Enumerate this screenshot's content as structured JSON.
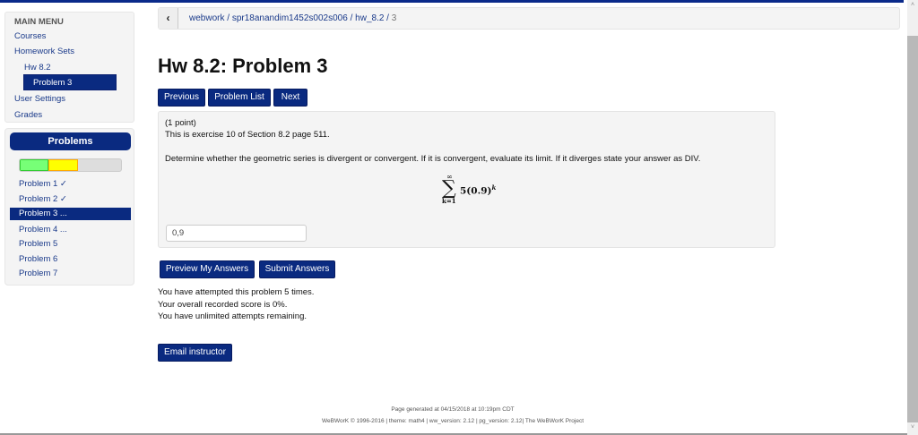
{
  "menu": {
    "title": "MAIN MENU",
    "items": [
      "Courses",
      "Homework Sets",
      "Hw 8.2",
      "Problem 3",
      "User Settings",
      "Grades"
    ]
  },
  "problems": {
    "title": "Problems",
    "progress": {
      "correct_fraction": 0.286,
      "attempted_fraction": 0.286
    },
    "items": [
      "Problem 1 ✓",
      "Problem 2 ✓",
      "Problem 3 ...",
      "Problem 4 ...",
      "Problem 5",
      "Problem 6",
      "Problem 7"
    ]
  },
  "breadcrumb": {
    "back": "‹",
    "parts": [
      "webwork",
      "spr18anandim1452s002s006",
      "hw_8.2"
    ],
    "current": "3"
  },
  "title": "Hw 8.2: Problem 3",
  "nav": {
    "previous": "Previous",
    "list": "Problem List",
    "next": "Next"
  },
  "problem": {
    "points": "(1 point)",
    "exercise": "This is exercise 10 of Section 8.2 page 511.",
    "question": "Determine whether the geometric series is divergent or convergent. If it is convergent, evaluate its limit. If it diverges state your answer as DIV.",
    "math": {
      "upper": "∞",
      "lower": "k=1",
      "term": "5(0.9)",
      "exp": "k"
    },
    "answer": "0,9"
  },
  "actions": {
    "preview": "Preview My Answers",
    "submit": "Submit Answers"
  },
  "status": [
    "You have attempted this problem 5 times.",
    "Your overall recorded score is 0%.",
    "You have unlimited attempts remaining."
  ],
  "email": "Email instructor",
  "footer": {
    "generated": "Page generated at 04/15/2018 at 10:19pm CDT",
    "credits": "WeBWorK © 1996-2016 | theme: math4 | ww_version: 2.12 | pg_version: 2.12| The WeBWorK Project"
  }
}
